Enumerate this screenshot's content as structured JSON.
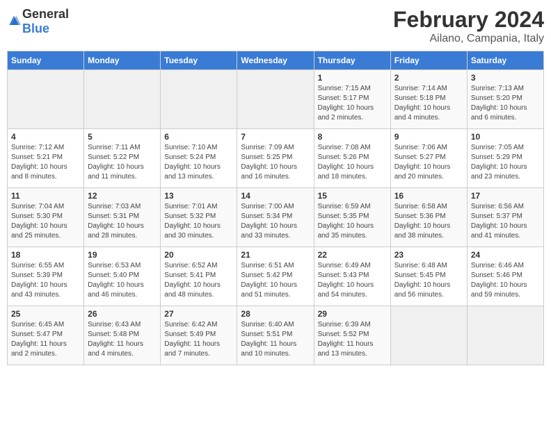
{
  "logo": {
    "general": "General",
    "blue": "Blue"
  },
  "title": "February 2024",
  "location": "Ailano, Campania, Italy",
  "weekdays": [
    "Sunday",
    "Monday",
    "Tuesday",
    "Wednesday",
    "Thursday",
    "Friday",
    "Saturday"
  ],
  "weeks": [
    [
      {
        "day": "",
        "info": ""
      },
      {
        "day": "",
        "info": ""
      },
      {
        "day": "",
        "info": ""
      },
      {
        "day": "",
        "info": ""
      },
      {
        "day": "1",
        "info": "Sunrise: 7:15 AM\nSunset: 5:17 PM\nDaylight: 10 hours\nand 2 minutes."
      },
      {
        "day": "2",
        "info": "Sunrise: 7:14 AM\nSunset: 5:18 PM\nDaylight: 10 hours\nand 4 minutes."
      },
      {
        "day": "3",
        "info": "Sunrise: 7:13 AM\nSunset: 5:20 PM\nDaylight: 10 hours\nand 6 minutes."
      }
    ],
    [
      {
        "day": "4",
        "info": "Sunrise: 7:12 AM\nSunset: 5:21 PM\nDaylight: 10 hours\nand 8 minutes."
      },
      {
        "day": "5",
        "info": "Sunrise: 7:11 AM\nSunset: 5:22 PM\nDaylight: 10 hours\nand 11 minutes."
      },
      {
        "day": "6",
        "info": "Sunrise: 7:10 AM\nSunset: 5:24 PM\nDaylight: 10 hours\nand 13 minutes."
      },
      {
        "day": "7",
        "info": "Sunrise: 7:09 AM\nSunset: 5:25 PM\nDaylight: 10 hours\nand 16 minutes."
      },
      {
        "day": "8",
        "info": "Sunrise: 7:08 AM\nSunset: 5:26 PM\nDaylight: 10 hours\nand 18 minutes."
      },
      {
        "day": "9",
        "info": "Sunrise: 7:06 AM\nSunset: 5:27 PM\nDaylight: 10 hours\nand 20 minutes."
      },
      {
        "day": "10",
        "info": "Sunrise: 7:05 AM\nSunset: 5:29 PM\nDaylight: 10 hours\nand 23 minutes."
      }
    ],
    [
      {
        "day": "11",
        "info": "Sunrise: 7:04 AM\nSunset: 5:30 PM\nDaylight: 10 hours\nand 25 minutes."
      },
      {
        "day": "12",
        "info": "Sunrise: 7:03 AM\nSunset: 5:31 PM\nDaylight: 10 hours\nand 28 minutes."
      },
      {
        "day": "13",
        "info": "Sunrise: 7:01 AM\nSunset: 5:32 PM\nDaylight: 10 hours\nand 30 minutes."
      },
      {
        "day": "14",
        "info": "Sunrise: 7:00 AM\nSunset: 5:34 PM\nDaylight: 10 hours\nand 33 minutes."
      },
      {
        "day": "15",
        "info": "Sunrise: 6:59 AM\nSunset: 5:35 PM\nDaylight: 10 hours\nand 35 minutes."
      },
      {
        "day": "16",
        "info": "Sunrise: 6:58 AM\nSunset: 5:36 PM\nDaylight: 10 hours\nand 38 minutes."
      },
      {
        "day": "17",
        "info": "Sunrise: 6:56 AM\nSunset: 5:37 PM\nDaylight: 10 hours\nand 41 minutes."
      }
    ],
    [
      {
        "day": "18",
        "info": "Sunrise: 6:55 AM\nSunset: 5:39 PM\nDaylight: 10 hours\nand 43 minutes."
      },
      {
        "day": "19",
        "info": "Sunrise: 6:53 AM\nSunset: 5:40 PM\nDaylight: 10 hours\nand 46 minutes."
      },
      {
        "day": "20",
        "info": "Sunrise: 6:52 AM\nSunset: 5:41 PM\nDaylight: 10 hours\nand 48 minutes."
      },
      {
        "day": "21",
        "info": "Sunrise: 6:51 AM\nSunset: 5:42 PM\nDaylight: 10 hours\nand 51 minutes."
      },
      {
        "day": "22",
        "info": "Sunrise: 6:49 AM\nSunset: 5:43 PM\nDaylight: 10 hours\nand 54 minutes."
      },
      {
        "day": "23",
        "info": "Sunrise: 6:48 AM\nSunset: 5:45 PM\nDaylight: 10 hours\nand 56 minutes."
      },
      {
        "day": "24",
        "info": "Sunrise: 6:46 AM\nSunset: 5:46 PM\nDaylight: 10 hours\nand 59 minutes."
      }
    ],
    [
      {
        "day": "25",
        "info": "Sunrise: 6:45 AM\nSunset: 5:47 PM\nDaylight: 11 hours\nand 2 minutes."
      },
      {
        "day": "26",
        "info": "Sunrise: 6:43 AM\nSunset: 5:48 PM\nDaylight: 11 hours\nand 4 minutes."
      },
      {
        "day": "27",
        "info": "Sunrise: 6:42 AM\nSunset: 5:49 PM\nDaylight: 11 hours\nand 7 minutes."
      },
      {
        "day": "28",
        "info": "Sunrise: 6:40 AM\nSunset: 5:51 PM\nDaylight: 11 hours\nand 10 minutes."
      },
      {
        "day": "29",
        "info": "Sunrise: 6:39 AM\nSunset: 5:52 PM\nDaylight: 11 hours\nand 13 minutes."
      },
      {
        "day": "",
        "info": ""
      },
      {
        "day": "",
        "info": ""
      }
    ]
  ]
}
